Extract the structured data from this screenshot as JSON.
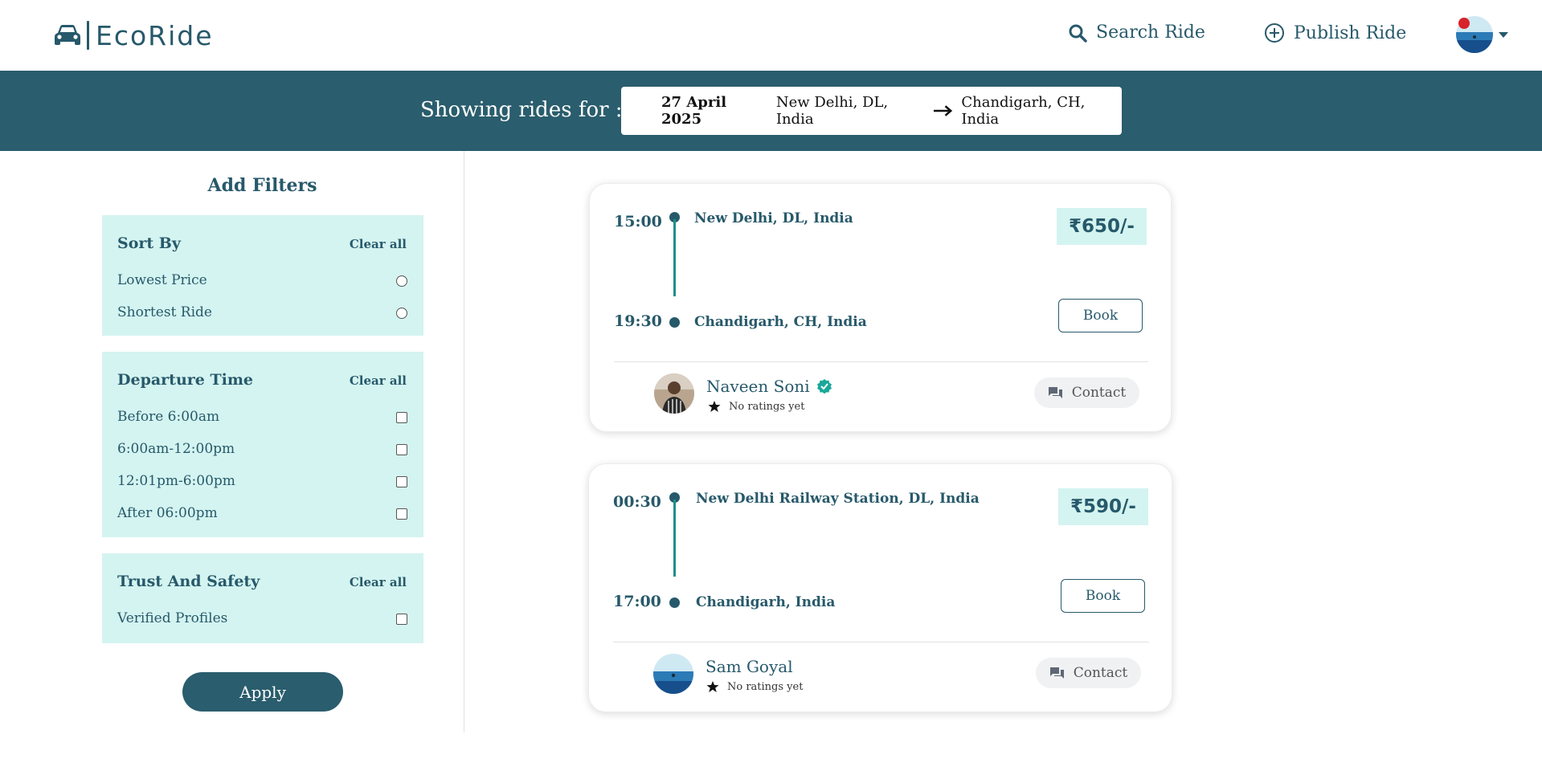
{
  "header": {
    "brand": "EcoRide",
    "nav": {
      "search_label": "Search Ride",
      "publish_label": "Publish Ride"
    }
  },
  "banner": {
    "label": "Showing rides for :",
    "date": "27 April 2025",
    "from": "New Delhi, DL, India",
    "to": "Chandigarh, CH, India"
  },
  "filters": {
    "title": "Add Filters",
    "sort_by": {
      "heading": "Sort By",
      "clear": "Clear all",
      "options": [
        "Lowest Price",
        "Shortest Ride"
      ]
    },
    "departure_time": {
      "heading": "Departure Time",
      "clear": "Clear all",
      "options": [
        "Before 6:00am",
        "6:00am-12:00pm",
        "12:01pm-6:00pm",
        "After 06:00pm"
      ]
    },
    "trust_safety": {
      "heading": "Trust And Safety",
      "clear": "Clear all",
      "options": [
        "Verified Profiles"
      ]
    },
    "apply_label": "Apply"
  },
  "rides": [
    {
      "depart_time": "15:00",
      "arrive_time": "19:30",
      "from": "New Delhi, DL, India",
      "to": "Chandigarh, CH, India",
      "price": "650/-",
      "currency": "₹",
      "book_label": "Book",
      "driver": "Naveen Soni",
      "verified": true,
      "rating_text": "No ratings yet",
      "contact_label": "Contact"
    },
    {
      "depart_time": "00:30",
      "arrive_time": "17:00",
      "from": "New Delhi Railway Station, DL, India",
      "to": "Chandigarh, India",
      "price": "590/-",
      "currency": "₹",
      "book_label": "Book",
      "driver": "Sam Goyal",
      "verified": false,
      "rating_text": "No ratings yet",
      "contact_label": "Contact"
    }
  ],
  "colors": {
    "primary": "#2a5d6d",
    "filter_bg": "#d4f4f1",
    "route_line": "#1e8f8a",
    "verified": "#1aa79a",
    "notification": "#d8232a"
  },
  "icons": [
    "car-icon",
    "search-icon",
    "plus-circle-icon",
    "user-avatar",
    "chevron-down-icon",
    "arrow-right-icon",
    "verified-badge-icon",
    "star-icon",
    "chat-icon"
  ]
}
